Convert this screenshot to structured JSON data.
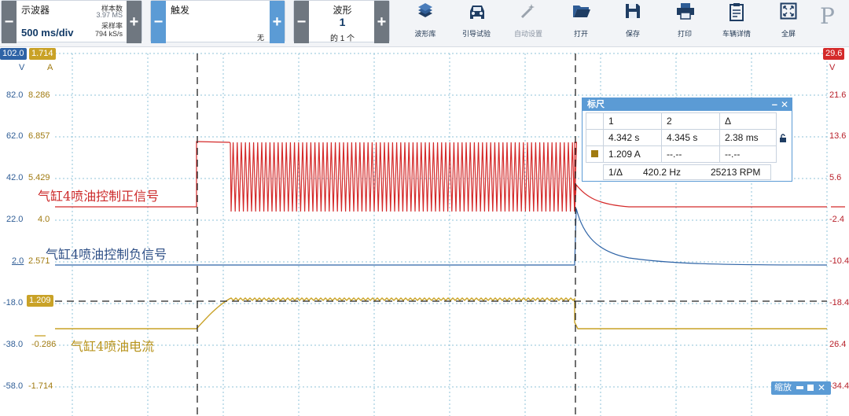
{
  "toolbar": {
    "scope": {
      "title": "示波器",
      "timebase": "500 ms/div",
      "samples_label": "样本数",
      "samples_value": "3.97 MS",
      "rate_label": "采样率",
      "rate_value": "794 kS/s"
    },
    "trigger": {
      "title": "触发",
      "mode": "无"
    },
    "waveform": {
      "title": "波形",
      "index": "1",
      "of_label": "的 1 个"
    },
    "buttons": [
      {
        "label": "波形库",
        "icon": "waveform-library-icon",
        "enabled": true
      },
      {
        "label": "引导试验",
        "icon": "car-icon",
        "enabled": true
      },
      {
        "label": "自动设置",
        "icon": "magic-wand-icon",
        "enabled": false
      },
      {
        "label": "打开",
        "icon": "folder-open-icon",
        "enabled": true
      },
      {
        "label": "保存",
        "icon": "save-icon",
        "enabled": true
      },
      {
        "label": "打印",
        "icon": "printer-icon",
        "enabled": true
      },
      {
        "label": "车辆详情",
        "icon": "clipboard-icon",
        "enabled": true
      },
      {
        "label": "全屏",
        "icon": "fullscreen-icon",
        "enabled": true
      }
    ],
    "logo_text": "P",
    "plus": "+",
    "minus": "−"
  },
  "axes": {
    "left_blue": {
      "top": "102.0",
      "unit": "V",
      "ticks": [
        "82.0",
        "62.0",
        "42.0",
        "22.0",
        "2.0",
        "-18.0",
        "-38.0",
        "-58.0"
      ]
    },
    "left_gold": {
      "top": "1.714",
      "unit": "A",
      "ticks": [
        "8.286",
        "6.857",
        "5.429",
        "4.0",
        "2.571",
        "-0.286",
        "-1.714"
      ],
      "cursor_value": "1.209"
    },
    "right_red": {
      "top": "29.6",
      "unit": "V",
      "ticks": [
        "21.6",
        "13.6",
        "5.6",
        "-2.4",
        "-10.4",
        "-18.4",
        "26.4",
        "-34.4"
      ]
    }
  },
  "channel_labels": {
    "red": "气缸4喷油控制正信号",
    "blue": "气缸4喷油控制负信号",
    "gold": "气缸4喷油电流"
  },
  "ruler": {
    "title": "标尺",
    "col1": "1",
    "col2": "2",
    "col_delta": "Δ",
    "t1": "4.342 s",
    "t2": "4.345 s",
    "t_delta": "2.38 ms",
    "a1": "1.209 A",
    "a2": "--.--",
    "a_delta": "--.--",
    "inv_label": "1/Δ",
    "freq": "420.2 Hz",
    "rpm": "25213 RPM",
    "min_btn": "–",
    "close_btn": "✕"
  },
  "zoom": {
    "label": "缩放"
  },
  "colors": {
    "red": "#d42a2a",
    "blue": "#2e63a6",
    "gold": "#c9a227",
    "grid": "#8fc3d8",
    "accent": "#5b9bd5"
  }
}
